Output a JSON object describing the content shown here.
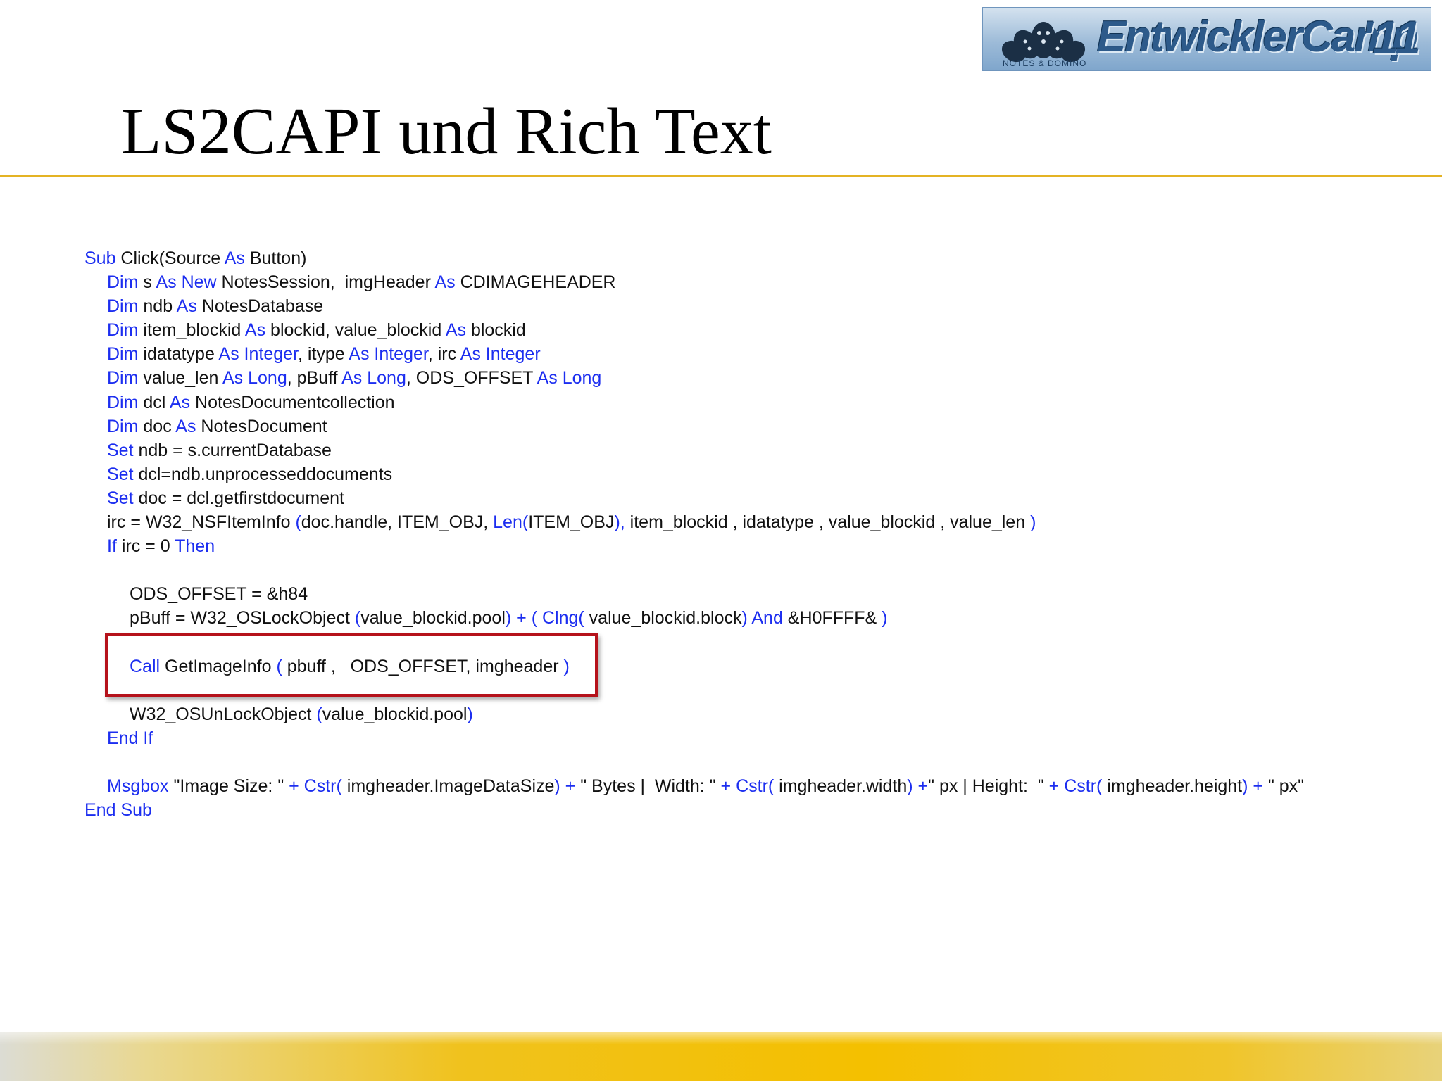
{
  "logo": {
    "name": "EntwicklerCamp",
    "year": "'11",
    "subtitle": "NOTES & DOMINO"
  },
  "slide": {
    "title": "LS2CAPI und Rich Text"
  },
  "code": {
    "lines": [
      {
        "indent": 0,
        "tokens": [
          {
            "t": "Sub",
            "k": true
          },
          {
            "t": " Click(Source "
          },
          {
            "t": "As",
            "k": true
          },
          {
            "t": " Button)"
          }
        ]
      },
      {
        "indent": 1,
        "tokens": [
          {
            "t": "Dim",
            "k": true
          },
          {
            "t": " s "
          },
          {
            "t": "As New",
            "k": true
          },
          {
            "t": " NotesSession,  imgHeader "
          },
          {
            "t": "As",
            "k": true
          },
          {
            "t": " CDIMAGEHEADER"
          }
        ]
      },
      {
        "indent": 1,
        "tokens": [
          {
            "t": "Dim",
            "k": true
          },
          {
            "t": " ndb "
          },
          {
            "t": "As",
            "k": true
          },
          {
            "t": " NotesDatabase"
          }
        ]
      },
      {
        "indent": 1,
        "tokens": [
          {
            "t": "Dim",
            "k": true
          },
          {
            "t": " item_blockid "
          },
          {
            "t": "As",
            "k": true
          },
          {
            "t": " blockid, value_blockid "
          },
          {
            "t": "As",
            "k": true
          },
          {
            "t": " blockid"
          }
        ]
      },
      {
        "indent": 1,
        "tokens": [
          {
            "t": "Dim",
            "k": true
          },
          {
            "t": " idatatype "
          },
          {
            "t": "As Integer",
            "k": true
          },
          {
            "t": ", itype "
          },
          {
            "t": "As Integer",
            "k": true
          },
          {
            "t": ", irc "
          },
          {
            "t": "As Integer",
            "k": true
          }
        ]
      },
      {
        "indent": 1,
        "tokens": [
          {
            "t": "Dim",
            "k": true
          },
          {
            "t": " value_len "
          },
          {
            "t": "As Long",
            "k": true
          },
          {
            "t": ", pBuff "
          },
          {
            "t": "As Long",
            "k": true
          },
          {
            "t": ", ODS_OFFSET "
          },
          {
            "t": "As Long",
            "k": true
          }
        ]
      },
      {
        "indent": 1,
        "tokens": [
          {
            "t": "Dim",
            "k": true
          },
          {
            "t": " dcl "
          },
          {
            "t": "As",
            "k": true
          },
          {
            "t": " NotesDocumentcollection"
          }
        ]
      },
      {
        "indent": 1,
        "tokens": [
          {
            "t": "Dim",
            "k": true
          },
          {
            "t": " doc "
          },
          {
            "t": "As",
            "k": true
          },
          {
            "t": " NotesDocument"
          }
        ]
      },
      {
        "indent": 1,
        "tokens": [
          {
            "t": "Set",
            "k": true
          },
          {
            "t": " ndb = s.currentDatabase"
          }
        ]
      },
      {
        "indent": 1,
        "tokens": [
          {
            "t": "Set",
            "k": true
          },
          {
            "t": " dcl=ndb.unprocesseddocuments"
          }
        ]
      },
      {
        "indent": 1,
        "tokens": [
          {
            "t": "Set",
            "k": true
          },
          {
            "t": " doc = dcl.getfirstdocument"
          }
        ]
      },
      {
        "indent": 1,
        "tokens": [
          {
            "t": "irc = W32_NSFItemInfo "
          },
          {
            "t": "(",
            "k": true
          },
          {
            "t": "doc.handle, ITEM_OBJ, "
          },
          {
            "t": "Len(",
            "k": true
          },
          {
            "t": "ITEM_OBJ"
          },
          {
            "t": "),",
            "k": true
          },
          {
            "t": " item_blockid , idatatype , value_blockid , value_len "
          },
          {
            "t": ")",
            "k": true
          }
        ]
      },
      {
        "indent": 1,
        "tokens": [
          {
            "t": "If",
            "k": true
          },
          {
            "t": " irc = 0 "
          },
          {
            "t": "Then",
            "k": true
          }
        ]
      },
      {
        "blank": true
      },
      {
        "indent": 2,
        "tokens": [
          {
            "t": "ODS_OFFSET = &h84"
          }
        ]
      },
      {
        "indent": 2,
        "tokens": [
          {
            "t": "pBuff = W32_OSLockObject "
          },
          {
            "t": "(",
            "k": true
          },
          {
            "t": "value_blockid.pool"
          },
          {
            "t": ") + ( ",
            "k": true
          },
          {
            "t": "Clng(",
            "k": true
          },
          {
            "t": " value_blockid.block"
          },
          {
            "t": ") And",
            "k": true
          },
          {
            "t": " &H0FFFF& "
          },
          {
            "t": ")",
            "k": true
          }
        ]
      },
      {
        "blank": true
      },
      {
        "indent": 2,
        "tokens": [
          {
            "t": "Call",
            "k": true
          },
          {
            "t": " GetImageInfo "
          },
          {
            "t": "(",
            "k": true
          },
          {
            "t": " pbuff ,   ODS_OFFSET, imgheader "
          },
          {
            "t": ")",
            "k": true
          }
        ]
      },
      {
        "blank": true
      },
      {
        "indent": 2,
        "tokens": [
          {
            "t": "W32_OSUnLockObject "
          },
          {
            "t": "(",
            "k": true
          },
          {
            "t": "value_blockid.pool"
          },
          {
            "t": ")",
            "k": true
          }
        ]
      },
      {
        "indent": 1,
        "tokens": [
          {
            "t": "End If",
            "k": true
          }
        ]
      },
      {
        "blank": true
      },
      {
        "indent": 1,
        "tokens": [
          {
            "t": "Msgbox",
            "k": true
          },
          {
            "t": " \"Image Size: \" "
          },
          {
            "t": "+ Cstr(",
            "k": true
          },
          {
            "t": " imgheader.ImageDataSize"
          },
          {
            "t": ") +",
            "k": true
          },
          {
            "t": " \" Bytes |  Width: \" "
          },
          {
            "t": "+ Cstr(",
            "k": true
          },
          {
            "t": " imgheader.width"
          },
          {
            "t": ") +",
            "k": true
          },
          {
            "t": "\" px | Height:  \" "
          },
          {
            "t": "+ Cstr(",
            "k": true
          },
          {
            "t": " imgheader.height"
          },
          {
            "t": ") +",
            "k": true
          },
          {
            "t": " \" px\""
          }
        ]
      },
      {
        "indent": 0,
        "tokens": [
          {
            "t": "End Sub",
            "k": true
          }
        ]
      }
    ]
  },
  "colors": {
    "keyword": "#1c2ef0",
    "text": "#111111",
    "highlight_border": "#b5121b",
    "rule": "#e4b324",
    "footer": "#f4c000"
  }
}
